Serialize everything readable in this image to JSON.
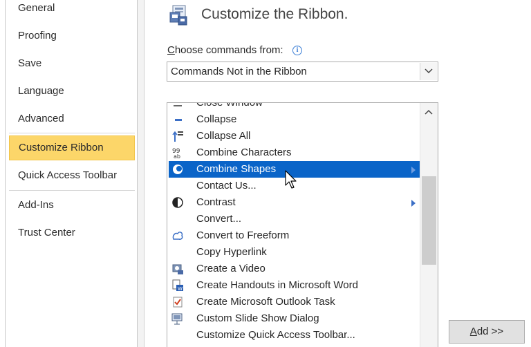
{
  "sidebar": {
    "items": [
      {
        "label": "General"
      },
      {
        "label": "Proofing"
      },
      {
        "label": "Save"
      },
      {
        "label": "Language"
      },
      {
        "label": "Advanced"
      },
      {
        "label": "Customize Ribbon",
        "selected": true
      },
      {
        "label": "Quick Access Toolbar"
      },
      {
        "label": "Add-Ins"
      },
      {
        "label": "Trust Center"
      }
    ]
  },
  "main": {
    "title": "Customize the Ribbon.",
    "choose_label_first": "C",
    "choose_label_rest": "hoose commands from:",
    "info_glyph": "i",
    "combo_value": "Commands Not in the Ribbon",
    "add_button_underlined": "A",
    "add_button_rest": "dd >>"
  },
  "commands": [
    {
      "label": "Close Window",
      "icon": "close-window-icon"
    },
    {
      "label": "Collapse",
      "icon": "collapse-icon"
    },
    {
      "label": "Collapse All",
      "icon": "collapse-all-icon"
    },
    {
      "label": "Combine Characters",
      "icon": "combine-characters-icon"
    },
    {
      "label": "Combine Shapes",
      "icon": "combine-shapes-icon",
      "selected": true,
      "submenu": true
    },
    {
      "label": "Contact Us...",
      "icon": ""
    },
    {
      "label": "Contrast",
      "icon": "contrast-icon",
      "submenu": true
    },
    {
      "label": "Convert...",
      "icon": ""
    },
    {
      "label": "Convert to Freeform",
      "icon": "convert-to-freeform-icon"
    },
    {
      "label": "Copy Hyperlink",
      "icon": ""
    },
    {
      "label": "Create a Video",
      "icon": "create-video-icon"
    },
    {
      "label": "Create Handouts in Microsoft Word",
      "icon": "create-handouts-icon"
    },
    {
      "label": "Create Microsoft Outlook Task",
      "icon": "outlook-task-icon"
    },
    {
      "label": "Custom Slide Show Dialog",
      "icon": "custom-slide-show-icon"
    },
    {
      "label": "Customize Quick Access Toolbar...",
      "icon": ""
    }
  ],
  "colors": {
    "selected_sidebar": "#fcd669",
    "selected_row": "#0a64c8"
  }
}
